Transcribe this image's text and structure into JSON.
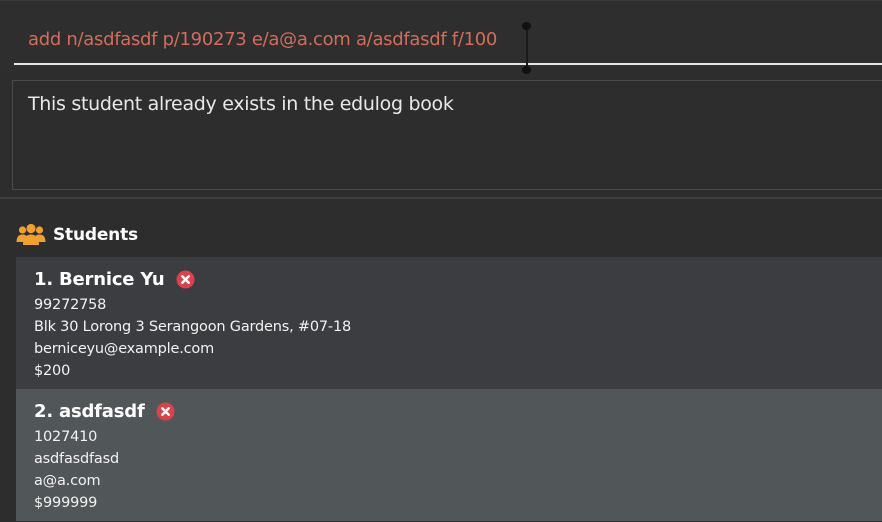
{
  "command_box": {
    "value": "add n/asdfasdf p/190273 e/a@a.com a/asdfasdf f/100"
  },
  "result_display": {
    "message": "This student already exists in the edulog book"
  },
  "student_panel": {
    "icon": "people-icon",
    "title": "Students",
    "accent_color": "#f0a030",
    "students": [
      {
        "index_name": "1. Bernice Yu",
        "phone": "99272758",
        "address": "Blk 30 Lorong 3 Serangoon Gardens, #07-18",
        "email": "berniceyu@example.com",
        "fee": "$200",
        "remove_icon": "remove-x-icon"
      },
      {
        "index_name": "2. asdfasdf",
        "phone": "1027410",
        "address": "asdfasdfasd",
        "email": "a@a.com",
        "fee": "$999999",
        "remove_icon": "remove-x-icon"
      }
    ]
  },
  "colors": {
    "command_text": "#d36d5b",
    "remove_badge": "#d9434b",
    "card_odd": "#3b3d40",
    "card_even": "#515658"
  }
}
